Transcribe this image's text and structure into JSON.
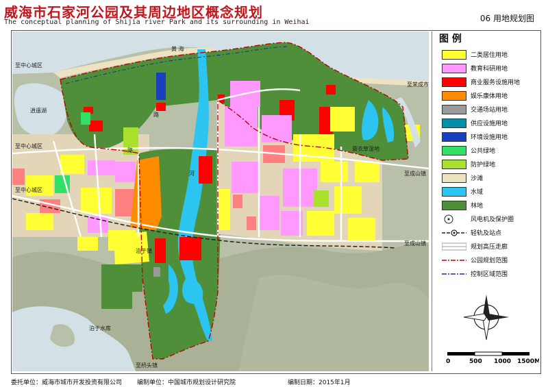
{
  "header": {
    "title_zh": "威海市石家河公园及其周边地区概念规划",
    "title_en": "The conceptual planning of Shijia river Park  and its surrounding in  Weihai",
    "sheet_number": "06 用地规划图"
  },
  "legend": {
    "title": "图 例",
    "items": [
      {
        "label": "二类居住用地",
        "color": "#ffff33",
        "icon": "swatch"
      },
      {
        "label": "教育科研用地",
        "color": "#ff99ff",
        "icon": "swatch"
      },
      {
        "label": "商业服务设施用地",
        "color": "#ff0000",
        "icon": "swatch"
      },
      {
        "label": "娱乐康体用地",
        "color": "#ff8c00",
        "icon": "swatch"
      },
      {
        "label": "交通场站用地",
        "color": "#999999",
        "icon": "swatch"
      },
      {
        "label": "供应设施用地",
        "color": "#008fa8",
        "icon": "swatch"
      },
      {
        "label": "环境设施用地",
        "color": "#1a3fbf",
        "icon": "swatch"
      },
      {
        "label": "公共绿地",
        "color": "#33e066",
        "icon": "swatch"
      },
      {
        "label": "防护绿地",
        "color": "#a8e22e",
        "icon": "swatch"
      },
      {
        "label": "沙滩",
        "color": "#eee3c0",
        "icon": "swatch"
      },
      {
        "label": "水域",
        "color": "#2cc4f0",
        "icon": "swatch"
      },
      {
        "label": "林地",
        "color": "#4f8f3a",
        "icon": "swatch"
      },
      {
        "label": "风电机及保护圈",
        "color": "#ffffff",
        "icon": "wind-turbine-icon"
      },
      {
        "label": "轻轨及站点",
        "color": "#ffffff",
        "icon": "light-rail-icon"
      },
      {
        "label": "规划高压走廊",
        "color": "#ffffff",
        "icon": "power-corridor-icon"
      },
      {
        "label": "公园规划范围",
        "color": "#ffffff",
        "icon": "park-boundary-icon"
      },
      {
        "label": "控制区域范围",
        "color": "#ffffff",
        "icon": "control-boundary-icon"
      }
    ],
    "north_arrow": "compass-rose-icon",
    "scale_bar": {
      "ticks": [
        "0",
        "500",
        "1000",
        "1500M"
      ]
    }
  },
  "map": {
    "labels": {
      "sea": "黄 海",
      "lake": "逍遥湖",
      "wetland": "蓑衣草湿地",
      "town": "泊于镇",
      "reservoir": "泊于水库",
      "to_rongcheng": "至荣成市",
      "to_city_center_1": "至中心城区",
      "to_city_center_2": "至中心城区",
      "to_city_center_3": "至中心城区",
      "to_chengshan_1": "至成山镇",
      "to_chengshan_2": "至成山镇",
      "to_qiaotou": "至桥头镇",
      "road_1": "路",
      "road_2": "路",
      "river_label": "河"
    }
  },
  "footer": {
    "client": "委托单位：威海市城市开发投资有限公司",
    "designer": "编制单位：中国城市规划设计研究院",
    "date": "编制日期：2015年1月"
  }
}
